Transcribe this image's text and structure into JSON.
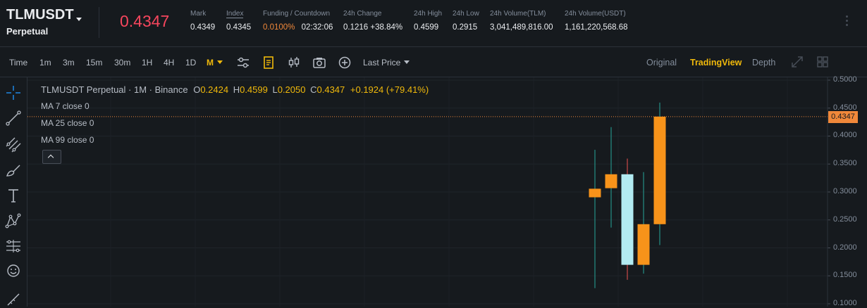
{
  "ticker": {
    "symbol": "TLMUSDT",
    "contract_type": "Perpetual",
    "last_price": "0.4347",
    "stats": [
      {
        "label": "Mark",
        "value": "0.4349"
      },
      {
        "label": "Index",
        "value": "0.4345"
      },
      {
        "label": "Funding / Countdown",
        "funding": "0.0100%",
        "countdown": "02:32:06"
      },
      {
        "label": "24h Change",
        "value": "0.1216 +38.84%"
      },
      {
        "label": "24h High",
        "value": "0.4599"
      },
      {
        "label": "24h Low",
        "value": "0.2915"
      },
      {
        "label": "24h Volume(TLM)",
        "value": "3,041,489,816.00"
      },
      {
        "label": "24h Volume(USDT)",
        "value": "1,161,220,568.68"
      }
    ]
  },
  "toolbar": {
    "intervals": [
      "Time",
      "1m",
      "3m",
      "15m",
      "30m",
      "1H",
      "4H",
      "1D",
      "M"
    ],
    "selected_interval": "M",
    "price_type": "Last Price",
    "views": [
      "Original",
      "TradingView",
      "Depth"
    ],
    "selected_view": "TradingView",
    "icons": [
      "indicator-settings-icon",
      "favorite-bookmark-icon",
      "candle-style-icon",
      "camera-icon",
      "add-circle-icon",
      "expand-icon",
      "layout-grid-icon"
    ]
  },
  "drawing_tools": [
    "crosshair-icon",
    "trend-line-icon",
    "fib-channel-icon",
    "brush-icon",
    "text-icon",
    "pattern-icon",
    "measure-icon",
    "emoji-icon",
    "ruler-icon"
  ],
  "legend": {
    "title": "TLMUSDT Perpetual · 1M · Binance",
    "o_label": "O",
    "o_value": "0.2424",
    "h_label": "H",
    "h_value": "0.4599",
    "l_label": "L",
    "l_value": "0.2050",
    "c_label": "C",
    "c_value": "0.4347",
    "change": "+0.1924 (+79.41%)",
    "ma": [
      "MA 7 close 0",
      "MA 25 close 0",
      "MA 99 close 0"
    ]
  },
  "chart_data": {
    "type": "candlestick",
    "ylim": [
      0.095,
      0.505
    ],
    "y_ticks": [
      "0.5000",
      "0.4500",
      "0.4000",
      "0.3500",
      "0.3000",
      "0.2500",
      "0.2000",
      "0.1500",
      "0.1000"
    ],
    "last_price_line": 0.4347,
    "last_price_label": "0.4347",
    "candles": [
      {
        "open": 0.3058,
        "high": 0.3755,
        "low": 0.128,
        "close": 0.2905,
        "color": "#f7931a"
      },
      {
        "open": 0.3068,
        "high": 0.416,
        "low": 0.2363,
        "close": 0.3317,
        "color": "#f7931a"
      },
      {
        "open": 0.3317,
        "high": 0.3597,
        "low": 0.143,
        "close": 0.1697,
        "color": "#b2ebf2"
      },
      {
        "open": 0.1697,
        "high": 0.3355,
        "low": 0.154,
        "close": 0.2424,
        "color": "#f7931a"
      },
      {
        "open": 0.2424,
        "high": 0.4599,
        "low": 0.205,
        "close": 0.4347,
        "color": "#f7931a"
      }
    ],
    "colors": {
      "up": "#f7931a",
      "down": "#b2ebf2",
      "last_price": "#f0883a"
    }
  }
}
